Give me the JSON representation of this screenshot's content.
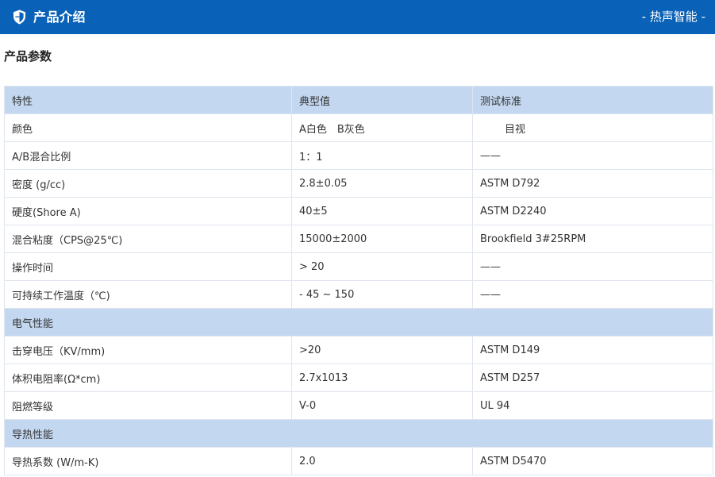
{
  "header": {
    "title": "产品介绍",
    "brand": "- 热声智能 -",
    "icon": "shield-icon",
    "background": "#0a62b8"
  },
  "section": {
    "title": "产品参数"
  },
  "table": {
    "headers": [
      "特性",
      "典型值",
      "测试标准"
    ],
    "rows": [
      {
        "type": "data",
        "cells": [
          "颜色",
          "A白色　B灰色",
          "目视"
        ]
      },
      {
        "type": "data",
        "cells": [
          "A/B混合比例",
          "1：1",
          "——"
        ]
      },
      {
        "type": "data",
        "cells": [
          "密度 (g/cc)",
          "2.8±0.05",
          "ASTM D792"
        ]
      },
      {
        "type": "data",
        "cells": [
          "硬度(Shore A)",
          "40±5",
          "ASTM D2240"
        ]
      },
      {
        "type": "data",
        "cells": [
          "混合粘度（CPS@25℃)",
          "15000±2000",
          "Brookfield 3#25RPM"
        ]
      },
      {
        "type": "data",
        "cells": [
          "操作时间",
          "> 20",
          "——"
        ]
      },
      {
        "type": "data",
        "cells": [
          "可持续工作温度（℃)",
          "- 45 ~ 150",
          "——"
        ]
      },
      {
        "type": "group",
        "label": "电气性能"
      },
      {
        "type": "data",
        "cells": [
          "击穿电压（KV/mm)",
          ">20",
          "ASTM D149"
        ]
      },
      {
        "type": "data",
        "cells": [
          "体积电阻率(Ω*cm)",
          "2.7x1013",
          "ASTM D257"
        ]
      },
      {
        "type": "data",
        "cells": [
          "阻燃等级",
          "V-0",
          "UL 94"
        ]
      },
      {
        "type": "group",
        "label": "导热性能"
      },
      {
        "type": "data",
        "cells": [
          "导热系数 (W/m-K)",
          "2.0",
          "ASTM D5470"
        ]
      }
    ]
  }
}
